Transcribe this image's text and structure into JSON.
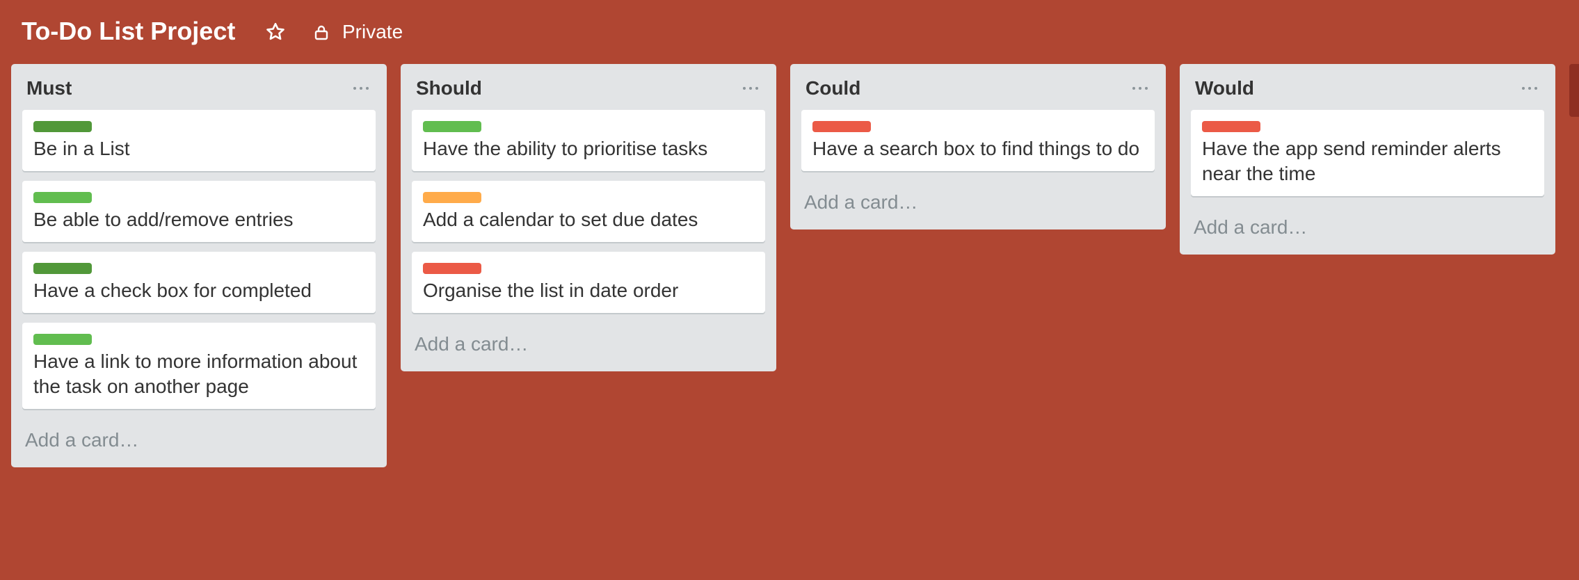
{
  "board": {
    "title": "To-Do List Project",
    "privacy": "Private",
    "background_color": "#b04632"
  },
  "label_colors": {
    "dark_green": "#519839",
    "green": "#61bd4f",
    "orange": "#ffab4a",
    "red": "#eb5a46"
  },
  "lists": [
    {
      "title": "Must",
      "add_card": "Add a card…",
      "cards": [
        {
          "label": "dark_green",
          "text": "Be in a List"
        },
        {
          "label": "green",
          "text": "Be able to add/remove entries"
        },
        {
          "label": "dark_green",
          "text": "Have a check box for completed"
        },
        {
          "label": "green",
          "text": "Have a link to more information about the task on another page"
        }
      ]
    },
    {
      "title": "Should",
      "add_card": "Add a card…",
      "cards": [
        {
          "label": "green",
          "text": "Have the ability to prioritise tasks"
        },
        {
          "label": "orange",
          "text": "Add a calendar to set due dates"
        },
        {
          "label": "red",
          "text": "Organise the list in date order"
        }
      ]
    },
    {
      "title": "Could",
      "add_card": "Add a card…",
      "cards": [
        {
          "label": "red",
          "text": "Have a search box to find things to do"
        }
      ]
    },
    {
      "title": "Would",
      "add_card": "Add a card…",
      "cards": [
        {
          "label": "red",
          "text": "Have the app send reminder alerts near the time"
        }
      ]
    }
  ]
}
